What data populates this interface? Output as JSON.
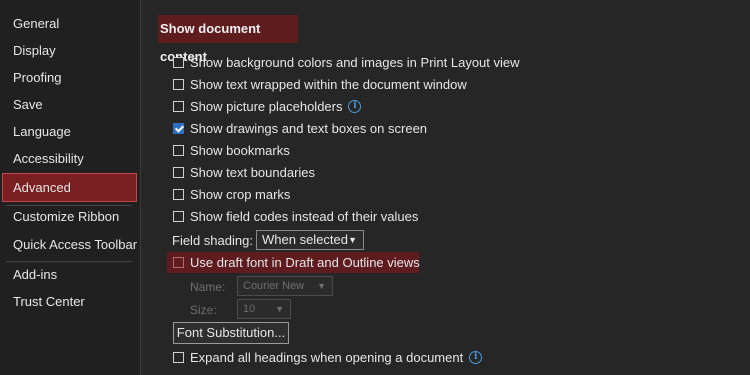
{
  "sidebar": {
    "items": [
      {
        "label": "General"
      },
      {
        "label": "Display"
      },
      {
        "label": "Proofing"
      },
      {
        "label": "Save"
      },
      {
        "label": "Language"
      },
      {
        "label": "Accessibility"
      },
      {
        "label": "Advanced",
        "active": true
      },
      {
        "label": "Customize Ribbon"
      },
      {
        "label": "Quick Access Toolbar"
      },
      {
        "label": "Add-ins"
      },
      {
        "label": "Trust Center"
      }
    ]
  },
  "main": {
    "section_title": "Show document content",
    "options": [
      {
        "label": "Show background colors and images in Print Layout view",
        "checked": false
      },
      {
        "label": "Show text wrapped within the document window",
        "checked": false
      },
      {
        "label": "Show picture placeholders",
        "checked": false,
        "info_icon": "info-icon"
      },
      {
        "label": "Show drawings and text boxes on screen",
        "checked": true
      },
      {
        "label": "Show bookmarks",
        "checked": false
      },
      {
        "label": "Show text boundaries",
        "checked": false
      },
      {
        "label": "Show crop marks",
        "checked": false
      },
      {
        "label": "Show field codes instead of their values",
        "checked": false
      }
    ],
    "field_shading": {
      "label": "Field shading:",
      "value": "When selected"
    },
    "draft_font": {
      "label": "Use draft font in Draft and Outline views",
      "checked": false
    },
    "name": {
      "label": "Name:",
      "value": "Courier New"
    },
    "size": {
      "label": "Size:",
      "value": "10"
    },
    "font_substitution_button": "Font Substitution...",
    "expand_headings": {
      "label": "Expand all headings when opening a document",
      "checked": false,
      "info_icon": "info-icon"
    }
  },
  "colors": {
    "accent_selected": "#7a1f22",
    "accent_border": "#c0474b",
    "checkbox_checked": "#2b6fc2",
    "info_icon": "#4a9be0"
  }
}
